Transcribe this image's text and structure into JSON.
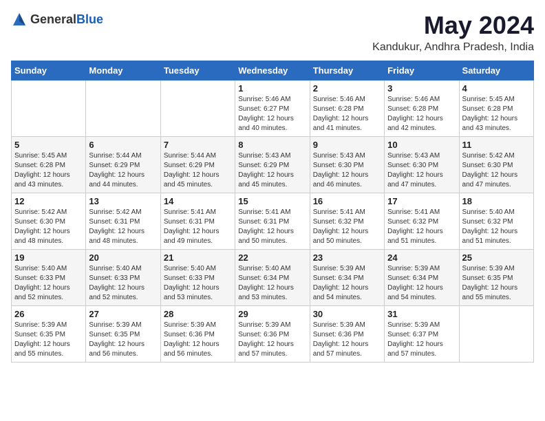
{
  "logo": {
    "text_general": "General",
    "text_blue": "Blue"
  },
  "calendar": {
    "title": "May 2024",
    "subtitle": "Kandukur, Andhra Pradesh, India",
    "days_of_week": [
      "Sunday",
      "Monday",
      "Tuesday",
      "Wednesday",
      "Thursday",
      "Friday",
      "Saturday"
    ],
    "weeks": [
      [
        {
          "day": "",
          "info": ""
        },
        {
          "day": "",
          "info": ""
        },
        {
          "day": "",
          "info": ""
        },
        {
          "day": "1",
          "info": "Sunrise: 5:46 AM\nSunset: 6:27 PM\nDaylight: 12 hours\nand 40 minutes."
        },
        {
          "day": "2",
          "info": "Sunrise: 5:46 AM\nSunset: 6:28 PM\nDaylight: 12 hours\nand 41 minutes."
        },
        {
          "day": "3",
          "info": "Sunrise: 5:46 AM\nSunset: 6:28 PM\nDaylight: 12 hours\nand 42 minutes."
        },
        {
          "day": "4",
          "info": "Sunrise: 5:45 AM\nSunset: 6:28 PM\nDaylight: 12 hours\nand 43 minutes."
        }
      ],
      [
        {
          "day": "5",
          "info": "Sunrise: 5:45 AM\nSunset: 6:28 PM\nDaylight: 12 hours\nand 43 minutes."
        },
        {
          "day": "6",
          "info": "Sunrise: 5:44 AM\nSunset: 6:29 PM\nDaylight: 12 hours\nand 44 minutes."
        },
        {
          "day": "7",
          "info": "Sunrise: 5:44 AM\nSunset: 6:29 PM\nDaylight: 12 hours\nand 45 minutes."
        },
        {
          "day": "8",
          "info": "Sunrise: 5:43 AM\nSunset: 6:29 PM\nDaylight: 12 hours\nand 45 minutes."
        },
        {
          "day": "9",
          "info": "Sunrise: 5:43 AM\nSunset: 6:30 PM\nDaylight: 12 hours\nand 46 minutes."
        },
        {
          "day": "10",
          "info": "Sunrise: 5:43 AM\nSunset: 6:30 PM\nDaylight: 12 hours\nand 47 minutes."
        },
        {
          "day": "11",
          "info": "Sunrise: 5:42 AM\nSunset: 6:30 PM\nDaylight: 12 hours\nand 47 minutes."
        }
      ],
      [
        {
          "day": "12",
          "info": "Sunrise: 5:42 AM\nSunset: 6:30 PM\nDaylight: 12 hours\nand 48 minutes."
        },
        {
          "day": "13",
          "info": "Sunrise: 5:42 AM\nSunset: 6:31 PM\nDaylight: 12 hours\nand 48 minutes."
        },
        {
          "day": "14",
          "info": "Sunrise: 5:41 AM\nSunset: 6:31 PM\nDaylight: 12 hours\nand 49 minutes."
        },
        {
          "day": "15",
          "info": "Sunrise: 5:41 AM\nSunset: 6:31 PM\nDaylight: 12 hours\nand 50 minutes."
        },
        {
          "day": "16",
          "info": "Sunrise: 5:41 AM\nSunset: 6:32 PM\nDaylight: 12 hours\nand 50 minutes."
        },
        {
          "day": "17",
          "info": "Sunrise: 5:41 AM\nSunset: 6:32 PM\nDaylight: 12 hours\nand 51 minutes."
        },
        {
          "day": "18",
          "info": "Sunrise: 5:40 AM\nSunset: 6:32 PM\nDaylight: 12 hours\nand 51 minutes."
        }
      ],
      [
        {
          "day": "19",
          "info": "Sunrise: 5:40 AM\nSunset: 6:33 PM\nDaylight: 12 hours\nand 52 minutes."
        },
        {
          "day": "20",
          "info": "Sunrise: 5:40 AM\nSunset: 6:33 PM\nDaylight: 12 hours\nand 52 minutes."
        },
        {
          "day": "21",
          "info": "Sunrise: 5:40 AM\nSunset: 6:33 PM\nDaylight: 12 hours\nand 53 minutes."
        },
        {
          "day": "22",
          "info": "Sunrise: 5:40 AM\nSunset: 6:34 PM\nDaylight: 12 hours\nand 53 minutes."
        },
        {
          "day": "23",
          "info": "Sunrise: 5:39 AM\nSunset: 6:34 PM\nDaylight: 12 hours\nand 54 minutes."
        },
        {
          "day": "24",
          "info": "Sunrise: 5:39 AM\nSunset: 6:34 PM\nDaylight: 12 hours\nand 54 minutes."
        },
        {
          "day": "25",
          "info": "Sunrise: 5:39 AM\nSunset: 6:35 PM\nDaylight: 12 hours\nand 55 minutes."
        }
      ],
      [
        {
          "day": "26",
          "info": "Sunrise: 5:39 AM\nSunset: 6:35 PM\nDaylight: 12 hours\nand 55 minutes."
        },
        {
          "day": "27",
          "info": "Sunrise: 5:39 AM\nSunset: 6:35 PM\nDaylight: 12 hours\nand 56 minutes."
        },
        {
          "day": "28",
          "info": "Sunrise: 5:39 AM\nSunset: 6:36 PM\nDaylight: 12 hours\nand 56 minutes."
        },
        {
          "day": "29",
          "info": "Sunrise: 5:39 AM\nSunset: 6:36 PM\nDaylight: 12 hours\nand 57 minutes."
        },
        {
          "day": "30",
          "info": "Sunrise: 5:39 AM\nSunset: 6:36 PM\nDaylight: 12 hours\nand 57 minutes."
        },
        {
          "day": "31",
          "info": "Sunrise: 5:39 AM\nSunset: 6:37 PM\nDaylight: 12 hours\nand 57 minutes."
        },
        {
          "day": "",
          "info": ""
        }
      ]
    ]
  }
}
